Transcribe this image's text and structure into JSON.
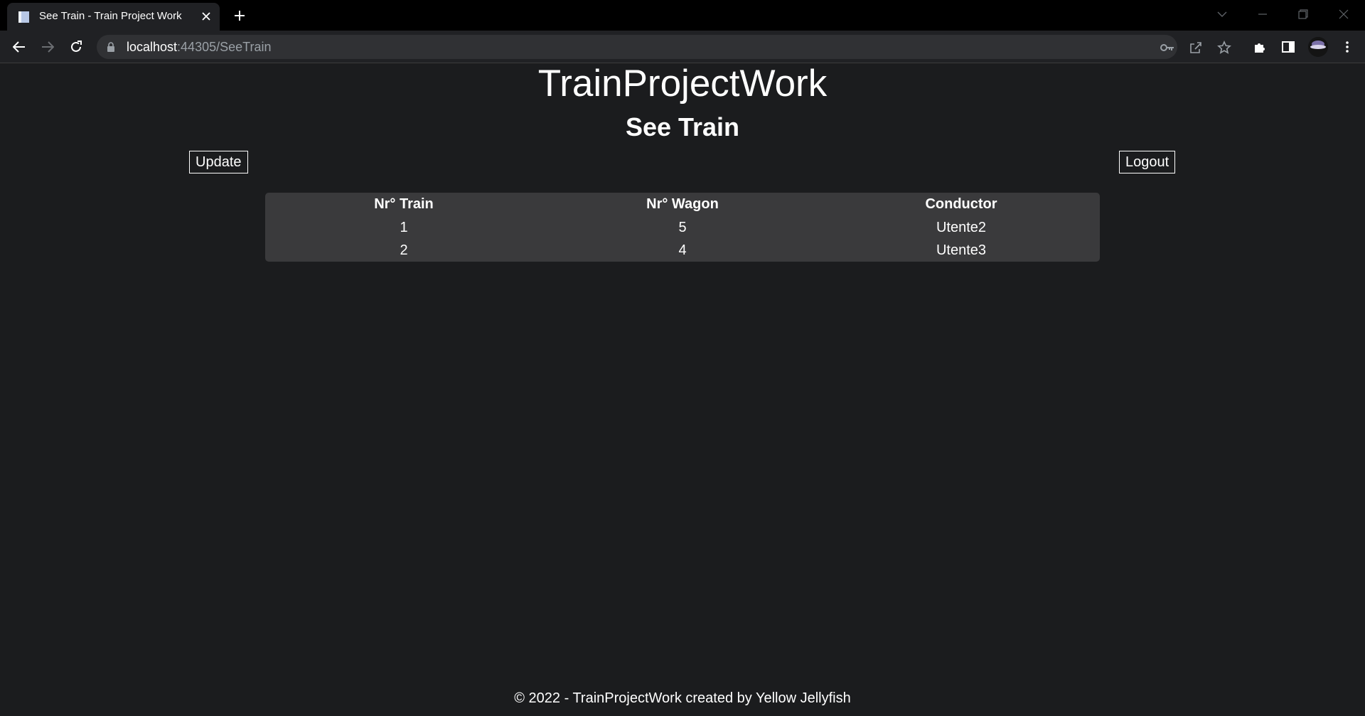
{
  "browser": {
    "tab_title": "See Train - Train Project Work",
    "url_host": "localhost",
    "url_rest": ":44305/SeeTrain"
  },
  "page": {
    "site_title": "TrainProjectWork",
    "page_title": "See Train",
    "update_label": "Update",
    "logout_label": "Logout"
  },
  "table": {
    "headers": [
      "Nr° Train",
      "Nr° Wagon",
      "Conductor"
    ],
    "rows": [
      [
        "1",
        "5",
        "Utente2"
      ],
      [
        "2",
        "4",
        "Utente3"
      ]
    ]
  },
  "footer": {
    "text": "© 2022 - TrainProjectWork created by Yellow Jellyfish"
  },
  "colors": {
    "page_background": "#1b1c1e",
    "table_background": "#3a3a3c",
    "chrome_background": "#202124",
    "tabstrip_background": "#000000"
  }
}
